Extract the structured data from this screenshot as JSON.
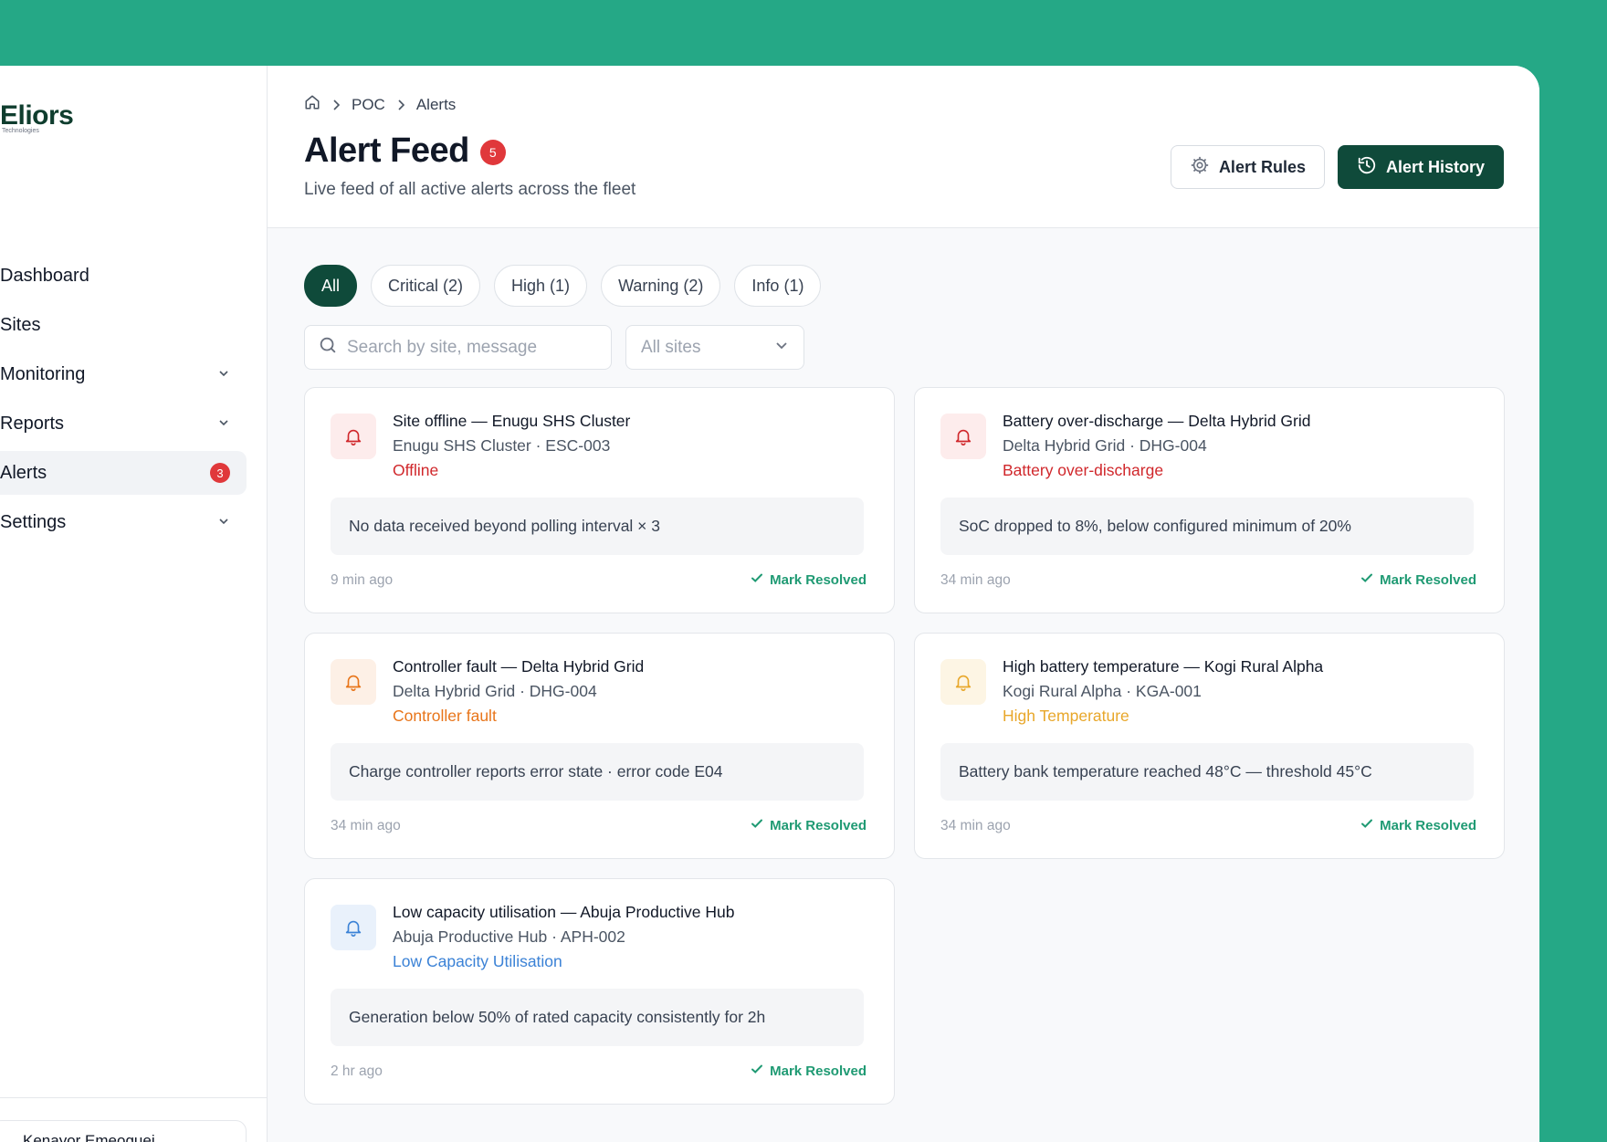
{
  "brand": {
    "name": "Eliors",
    "tagline": "Technologies"
  },
  "sidebar": {
    "items": [
      {
        "label": "Dashboard",
        "chevron": false,
        "active": false
      },
      {
        "label": "Sites",
        "chevron": false,
        "active": false
      },
      {
        "label": "Monitoring",
        "chevron": true,
        "active": false
      },
      {
        "label": "Reports",
        "chevron": true,
        "active": false
      },
      {
        "label": "Alerts",
        "chevron": false,
        "active": true,
        "badge": "3"
      },
      {
        "label": "Settings",
        "chevron": true,
        "active": false
      }
    ],
    "user_name": "Kenayor Emeoguei"
  },
  "breadcrumb": {
    "home_icon": "home-icon",
    "items": [
      "POC",
      "Alerts"
    ]
  },
  "header": {
    "title": "Alert Feed",
    "title_badge": "5",
    "subtitle": "Live feed of all active alerts across the fleet",
    "alert_rules_label": "Alert Rules",
    "alert_history_label": "Alert History"
  },
  "filters": [
    {
      "label": "All",
      "active": true
    },
    {
      "label": "Critical (2)",
      "active": false
    },
    {
      "label": "High (1)",
      "active": false
    },
    {
      "label": "Warning (2)",
      "active": false
    },
    {
      "label": "Info (1)",
      "active": false
    }
  ],
  "search": {
    "placeholder": "Search by site, message"
  },
  "site_select": {
    "value": "All sites"
  },
  "colors": {
    "brand_bg": "#25a886",
    "primary": "#0f4a3a",
    "critical": "#d0272b",
    "high": "#e8751a",
    "warning": "#e8a72a",
    "info": "#3b82d6",
    "resolve": "#1f9a73"
  },
  "alerts": [
    {
      "title": "Site offline — Enugu SHS Cluster",
      "site": "Enugu SHS Cluster · ESC-003",
      "type": "Offline",
      "severity": "critical",
      "message": "No data received beyond polling interval × 3",
      "time": "9 min ago",
      "action": "Mark Resolved"
    },
    {
      "title": "Battery over-discharge — Delta Hybrid Grid",
      "site": "Delta Hybrid Grid · DHG-004",
      "type": "Battery over-discharge",
      "severity": "critical",
      "message": "SoC dropped to 8%, below configured minimum of 20%",
      "time": "34 min ago",
      "action": "Mark Resolved"
    },
    {
      "title": "Controller fault — Delta Hybrid Grid",
      "site": "Delta Hybrid Grid · DHG-004",
      "type": "Controller fault",
      "severity": "high",
      "message": "Charge controller reports error state · error code E04",
      "time": "34 min ago",
      "action": "Mark Resolved"
    },
    {
      "title": "High battery temperature — Kogi Rural Alpha",
      "site": "Kogi Rural Alpha · KGA-001",
      "type": "High Temperature",
      "severity": "warning",
      "message": "Battery bank temperature reached 48°C — threshold 45°C",
      "time": "34 min ago",
      "action": "Mark Resolved"
    },
    {
      "title": "Low capacity utilisation — Abuja Productive Hub",
      "site": "Abuja Productive Hub · APH-002",
      "type": "Low Capacity Utilisation",
      "severity": "info",
      "message": "Generation below 50% of rated capacity consistently for 2h",
      "time": "2 hr ago",
      "action": "Mark Resolved"
    }
  ]
}
